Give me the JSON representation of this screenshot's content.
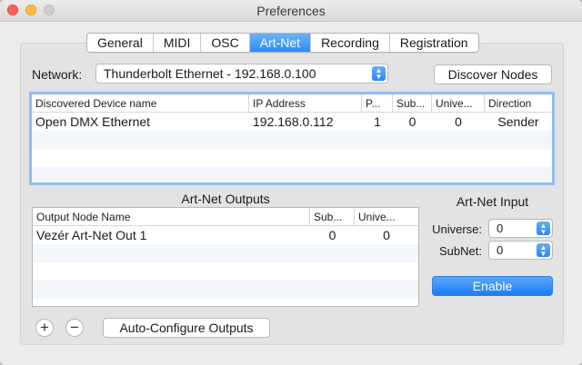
{
  "window": {
    "title": "Preferences"
  },
  "tabs": [
    {
      "label": "General",
      "active": false
    },
    {
      "label": "MIDI",
      "active": false
    },
    {
      "label": "OSC",
      "active": false
    },
    {
      "label": "Art-Net",
      "active": true
    },
    {
      "label": "Recording",
      "active": false
    },
    {
      "label": "Registration",
      "active": false
    }
  ],
  "network": {
    "label": "Network:",
    "value": "Thunderbolt Ethernet - 192.168.0.100"
  },
  "discover_button": "Discover Nodes",
  "devices": {
    "headers": [
      "Discovered Device name",
      "IP Address",
      "P...",
      "Sub...",
      "Unive...",
      "Direction"
    ],
    "rows": [
      [
        "Open DMX Ethernet",
        "192.168.0.112",
        "1",
        "0",
        "0",
        "Sender"
      ]
    ]
  },
  "outputs": {
    "title": "Art-Net Outputs",
    "headers": [
      "Output Node Name",
      "Sub...",
      "Unive..."
    ],
    "rows": [
      [
        "Vezér Art-Net Out 1",
        "0",
        "0"
      ]
    ]
  },
  "input": {
    "title": "Art-Net Input",
    "universe_label": "Universe:",
    "universe_value": "0",
    "subnet_label": "SubNet:",
    "subnet_value": "0",
    "enable_button": "Enable"
  },
  "controls": {
    "add_symbol": "+",
    "remove_symbol": "−",
    "auto_configure": "Auto-Configure Outputs"
  },
  "colors": {
    "accent": "#2a8cf8",
    "focus_ring": "#8fbdf2"
  }
}
